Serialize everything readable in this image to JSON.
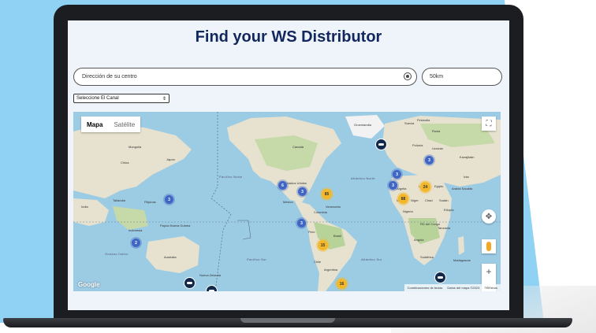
{
  "page": {
    "title": "Find your WS Distributor"
  },
  "search": {
    "address_value": "Dirección de su centro",
    "radius_value": "50km",
    "channel_selected": "Seleccione El Canal"
  },
  "map": {
    "type_map_label": "Mapa",
    "type_satellite_label": "Satélite",
    "google_label": "Google",
    "attribution": {
      "shortcuts": "Combinaciones de teclas",
      "data": "Datos del mapa ©2023",
      "terms": "Términos"
    },
    "ocean_labels": {
      "pacific_north": "Pacífico Norte",
      "atlantic_north": "Atlántico Norte",
      "pacific_south": "Pacífico Sur",
      "indian": "Océano Índico",
      "atlantic_south": "Atlántico Sur"
    },
    "place_labels": {
      "canada": "Canadá",
      "usa": "Estados Unidos",
      "mexico": "México",
      "brasil": "Brasil",
      "peru": "Perú",
      "argentina": "Argentina",
      "chile": "Chile",
      "bolivia": "Bolivia",
      "colombia": "Colombia",
      "venezuela": "Venezuela",
      "greenland": "Groenlandia",
      "russia": "Rusia",
      "china": "China",
      "mongolia": "Mongolia",
      "india": "India",
      "australia": "Australia",
      "indonesia": "Indonesia",
      "japan": "Japón",
      "kazajistan": "Kazajistán",
      "iran": "Irán",
      "egipto": "Egipto",
      "argelia": "Argelia",
      "libia": "Libia",
      "mali": "Malí",
      "niger": "Níger",
      "chad": "Chad",
      "sudan": "Sudán",
      "etiopia": "Etiopía",
      "angola": "Angola",
      "sudafrica": "Sudáfrica",
      "madagascar": "Madagascar",
      "rd_congo": "RD del Congo",
      "tanzania": "Tanzania",
      "nigeria": "Nigeria",
      "polonia": "Polonia",
      "ucrania": "Ucrania",
      "suecia": "Suecia",
      "finlandia": "Finlandia",
      "papua": "Papúa Nueva Guinea",
      "nueva_zelanda": "Nueva Zelanda",
      "filipinas": "Filipinas",
      "tailandia": "Tailandia",
      "arabia": "Arabia Saudita"
    },
    "clusters": [
      {
        "label": "3",
        "color": "blue"
      },
      {
        "label": "6",
        "color": "blue"
      },
      {
        "label": "3",
        "color": "blue"
      },
      {
        "label": "85",
        "color": "yellow"
      },
      {
        "label": "3",
        "color": "blue"
      },
      {
        "label": "3",
        "color": "blue"
      },
      {
        "label": "3",
        "color": "blue"
      },
      {
        "label": "24",
        "color": "yellow"
      },
      {
        "label": "88",
        "color": "yellow"
      },
      {
        "label": "15",
        "color": "yellow"
      },
      {
        "label": "16",
        "color": "yellow"
      },
      {
        "label": "2",
        "color": "blue"
      },
      {
        "label": "3",
        "color": "blue"
      }
    ],
    "colors": {
      "ocean": "#9ccbe4",
      "land": "#e6e2cf",
      "forest": "#c6d9a8",
      "cluster_blue": "#3f66c4",
      "cluster_yellow": "#f3b82a",
      "pin": "#13294b"
    }
  },
  "icons": {
    "location": "crosshair-icon",
    "fullscreen": "fullscreen-icon",
    "compass": "compass-icon",
    "pegman": "pegman-icon",
    "zoom_in": "+",
    "zoom_out": "−"
  },
  "colors": {
    "title": "#12275e",
    "background": "#8fd2f4",
    "screen": "#eef4f9"
  }
}
